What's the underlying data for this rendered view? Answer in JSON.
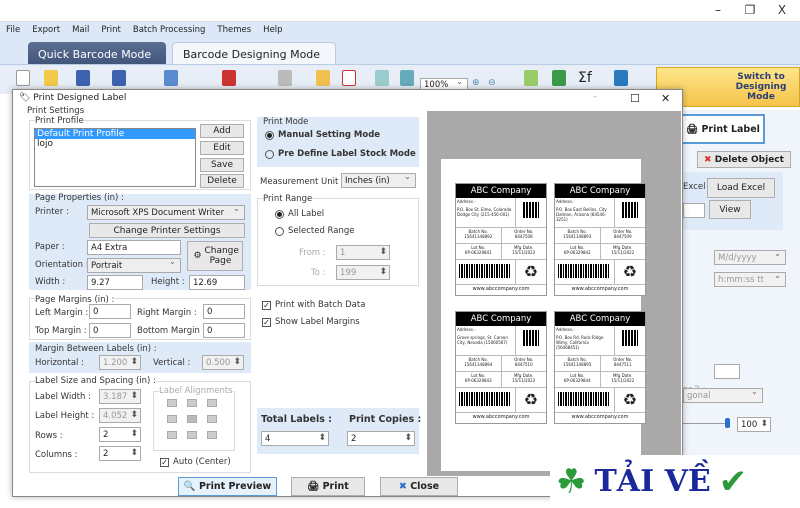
{
  "window": {
    "minimize": "–",
    "restore": "❐",
    "close": "X"
  },
  "menu": [
    "File",
    "Export",
    "Mail",
    "Print",
    "Batch Processing",
    "Themes",
    "Help"
  ],
  "tabs": {
    "quick": "Quick Barcode Mode",
    "designing": "Barcode Designing Mode"
  },
  "toolbar": {
    "zoom": "100%",
    "switch": "Switch to Designing Mode"
  },
  "right_panel": {
    "print_label": "Print Label",
    "delete_object": "Delete Object",
    "excel": "Excel",
    "load_excel": "Load Excel",
    "view": "View",
    "date_format": "M/d/yyyy",
    "time_format": "h:mm:ss tt",
    "color2": "or 2 :",
    "gradient": "gonal",
    "slider_value": "100"
  },
  "dialog": {
    "title": "Print Designed Label",
    "print_settings": "Print Settings",
    "print_profile": {
      "legend": "Print Profile",
      "items": [
        "Default Print Profile",
        "lojo"
      ],
      "selected": 0,
      "add": "Add",
      "edit": "Edit",
      "save": "Save",
      "delete": "Delete"
    },
    "page_properties": {
      "legend": "Page Properties (in) :",
      "printer_label": "Printer :",
      "printer": "Microsoft XPS Document Writer",
      "change_printer": "Change Printer Settings",
      "paper_label": "Paper :",
      "paper": "A4 Extra",
      "change_page": "Change Page",
      "orientation_label": "Orientation :",
      "orientation": "Portrait",
      "width_label": "Width :",
      "width": "9.27",
      "height_label": "Height :",
      "height": "12.69"
    },
    "page_margins": {
      "legend": "Page Margins (in) :",
      "left_label": "Left Margin :",
      "left": "0",
      "right_label": "Right Margin :",
      "right": "0",
      "top_label": "Top Margin :",
      "top": "0",
      "bottom_label": "Bottom Margin :",
      "bottom": "0"
    },
    "margin_between": {
      "legend": "Margin Between Labels (in) :",
      "horizontal_label": "Horizontal :",
      "horizontal": "1.200",
      "vertical_label": "Vertical :",
      "vertical": "0.500"
    },
    "label_size": {
      "legend": "Label Size and Spacing (in) :",
      "width_label": "Label Width :",
      "width": "3.187",
      "height_label": "Label Height :",
      "height": "4.052",
      "rows_label": "Rows :",
      "rows": "2",
      "columns_label": "Columns :",
      "columns": "2",
      "alignments": "Label Alignments",
      "auto_center": "Auto (Center)"
    },
    "print_mode": {
      "legend": "Print Mode",
      "manual": "Manual Setting Mode",
      "predefine": "Pre Define Label Stock Mode",
      "selected": "manual"
    },
    "measurement": {
      "label": "Measurement Unit :",
      "value": "Inches (in)"
    },
    "print_range": {
      "legend": "Print Range",
      "all": "All Label",
      "selected_range": "Selected Range",
      "from_label": "From :",
      "from": "1",
      "to_label": "To :",
      "to": "199",
      "selected": "all"
    },
    "print_with_batch": "Print with Batch Data",
    "show_label_margins": "Show Label Margins",
    "total_labels_label": "Total Labels :",
    "total_labels": "4",
    "print_copies_label": "Print Copies :",
    "print_copies": "2",
    "print_preview": "Print Preview",
    "print": "Print",
    "close": "Close"
  },
  "labels": [
    {
      "company": "ABC Company",
      "address_label": "Address.-",
      "address": "P.O. Box St. Elmo, Colorado Dodge City (215-456-001)",
      "batch_label": "Batch No.",
      "batch": "15641348892",
      "order_label": "Order No.",
      "order": "8447508",
      "lot_label": "Lot No.",
      "lot": "KP-06329841",
      "mfg_label": "Mfg Date.",
      "mfg": "15/11/2022",
      "website": "www.abccompany.com"
    },
    {
      "company": "ABC Company",
      "address_label": "Address.-",
      "address": "P.O. Box East Bellins, City Dalman, Arizona (84546-3251)",
      "batch_label": "Batch No.",
      "batch": "15641348893",
      "order_label": "Order No.",
      "order": "8447509",
      "lot_label": "Lot No.",
      "lot": "KP-06329842",
      "mfg_label": "Mfg Date.",
      "mfg": "15/11/2022",
      "website": "www.abccompany.com"
    },
    {
      "company": "ABC Company",
      "address_label": "Address.-",
      "address": "Grove springs, St. Carson City, Nevada (15060567)",
      "batch_label": "Batch No.",
      "batch": "15641348894",
      "order_label": "Order No.",
      "order": "8447510",
      "lot_label": "Lot No.",
      "lot": "KP-06329843",
      "mfg_label": "Mfg Date.",
      "mfg": "15/11/2022",
      "website": "www.abccompany.com"
    },
    {
      "company": "ABC Company",
      "address_label": "Address.-",
      "address": "P.O. Box Rd. Rock Ridge Wimy, California (56468451)",
      "batch_label": "Batch No.",
      "batch": "15641348895",
      "order_label": "Order No.",
      "order": "8447511",
      "lot_label": "Lot No.",
      "lot": "KP-06329844",
      "mfg_label": "Mfg Date.",
      "mfg": "15/11/2022",
      "website": "www.abccompany.com"
    }
  ],
  "watermark": {
    "text": "TẢI VỀ"
  },
  "colors": {
    "accent": "#3f5278",
    "selection": "#3399ff",
    "switch_bg": "#f5c34a",
    "panel_blue": "#dfeaf8"
  }
}
